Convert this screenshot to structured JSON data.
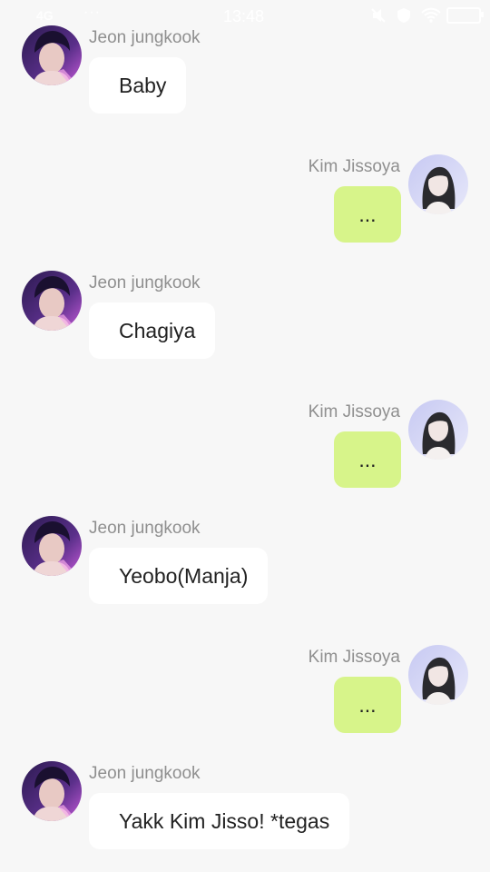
{
  "status_bar": {
    "network": "4G",
    "dots": "···",
    "time": "13:48"
  },
  "contacts": {
    "left": {
      "name": "Jeon jungkook",
      "avatar_icon": "jungkook-avatar-photo"
    },
    "right": {
      "name": "Kim Jissoya",
      "avatar_icon": "jisoo-avatar-photo"
    }
  },
  "colors": {
    "background": "#f7f7f7",
    "incoming_bubble": "#ffffff",
    "outgoing_bubble": "#d7f48a",
    "name_text": "#8f8f8f"
  },
  "messages": [
    {
      "side": "left",
      "sender": "Jeon jungkook",
      "text": "Baby"
    },
    {
      "side": "right",
      "sender": "Kim Jissoya",
      "text": "..."
    },
    {
      "side": "left",
      "sender": "Jeon jungkook",
      "text": "Chagiya"
    },
    {
      "side": "right",
      "sender": "Kim Jissoya",
      "text": "..."
    },
    {
      "side": "left",
      "sender": "Jeon jungkook",
      "text": "Yeobo(Manja)"
    },
    {
      "side": "right",
      "sender": "Kim Jissoya",
      "text": "..."
    },
    {
      "side": "left",
      "sender": "Jeon jungkook",
      "text": "Yakk Kim Jisso! *tegas"
    }
  ]
}
